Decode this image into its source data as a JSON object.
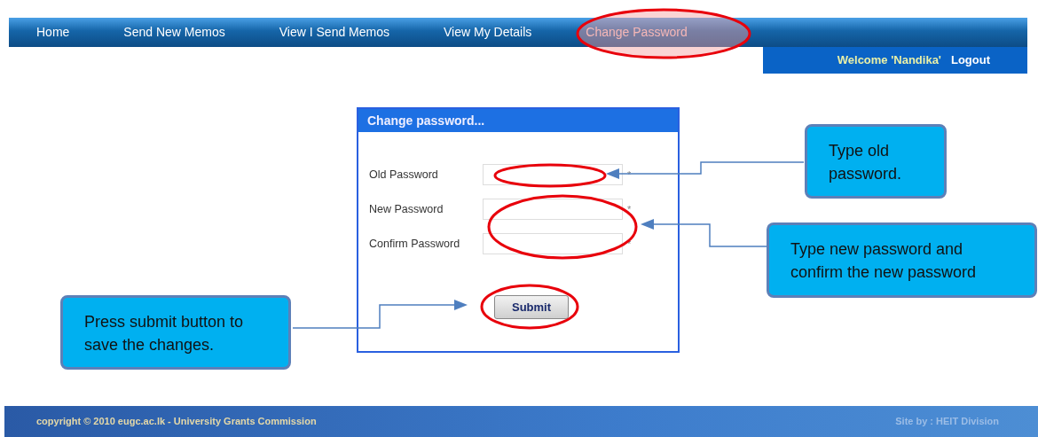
{
  "nav": {
    "items": [
      {
        "label": "Home",
        "selected": false
      },
      {
        "label": "Send New Memos",
        "selected": false
      },
      {
        "label": "View I Send Memos",
        "selected": false
      },
      {
        "label": "View My Details",
        "selected": false
      },
      {
        "label": "Change Password",
        "selected": true
      }
    ]
  },
  "user_bar": {
    "welcome": "Welcome 'Nandika'",
    "logout": "Logout"
  },
  "form": {
    "title": "Change password...",
    "fields": [
      {
        "label": "Old Password",
        "required_mark": "*"
      },
      {
        "label": "New Password",
        "required_mark": "*"
      },
      {
        "label": "Confirm Password",
        "required_mark": "*"
      }
    ],
    "submit": "Submit"
  },
  "annotations": [
    {
      "text": "Type old password."
    },
    {
      "text": "Type new password and confirm the new password"
    },
    {
      "text": "Press submit button to save the changes."
    }
  ],
  "footer": {
    "copyright": "copyright © 2010 eugc.ac.lk - University Grants Commission",
    "credit": "Site by : HEIT Division"
  }
}
